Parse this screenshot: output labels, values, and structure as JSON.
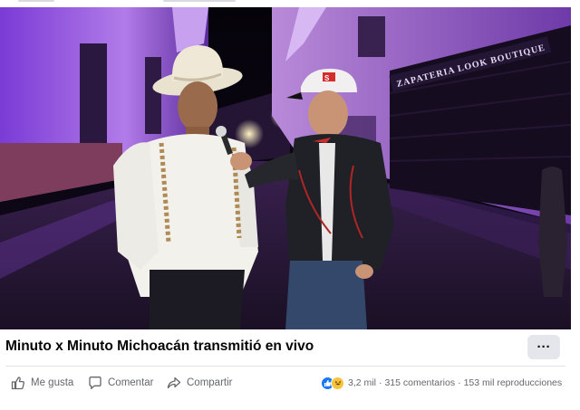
{
  "post": {
    "title": "Minuto x Minuto Michoacán transmitió en vivo",
    "more_label": "···"
  },
  "video": {
    "sign_text": "ZAPATERIA  LOOK  BOUTIQUE",
    "cap_text": "S"
  },
  "actions": {
    "like_label": "Me gusta",
    "comment_label": "Comentar",
    "share_label": "Compartir"
  },
  "stats": {
    "reactions_count": "3,2 mil",
    "comments_count": "315 comentarios",
    "separator": "·",
    "views_count": "153 mil reproducciones"
  },
  "colors": {
    "accent": "#1877f2",
    "muted_text": "#65676b",
    "button_bg": "#e4e6eb",
    "haha": "#f7c23c"
  },
  "icons": [
    "thumbs-up-icon",
    "comment-icon",
    "share-icon",
    "like-reaction-icon",
    "haha-reaction-icon",
    "more-icon"
  ]
}
